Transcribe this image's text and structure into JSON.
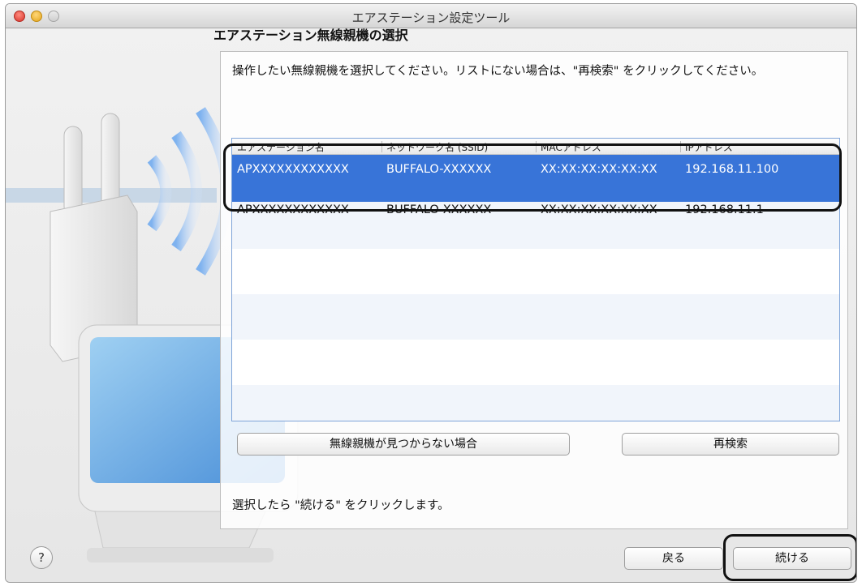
{
  "window": {
    "title": "エアステーション設定ツール"
  },
  "section_title": "エアステーション無線親機の選択",
  "instruction": "操作したい無線親機を選択してください。リストにない場合は、\"再検索\" をクリックしてください。",
  "table": {
    "columns": [
      "エアステーション名",
      "ネットワーク名 (SSID)",
      "MACアドレス",
      "IPアドレス"
    ],
    "rows": [
      {
        "name": "APXXXXXXXXXXXX",
        "ssid": "BUFFALO-XXXXXX",
        "mac": "XX:XX:XX:XX:XX:XX",
        "ip": "192.168.11.100",
        "selected": true
      },
      {
        "name": "APXXXXXXXXXXXX",
        "ssid": "BUFFALO-XXXXXX",
        "mac": "XX:XX:XX:XX:XX:XX",
        "ip": "192.168.11.1",
        "selected": false
      }
    ]
  },
  "buttons": {
    "not_found": "無線親機が見つからない場合",
    "rescan": "再検索",
    "back": "戻る",
    "continue": "続ける",
    "help": "?"
  },
  "footer_note": "選択したら \"続ける\" をクリックします。",
  "colors": {
    "selection": "#3874d8",
    "callout": "#111111"
  }
}
